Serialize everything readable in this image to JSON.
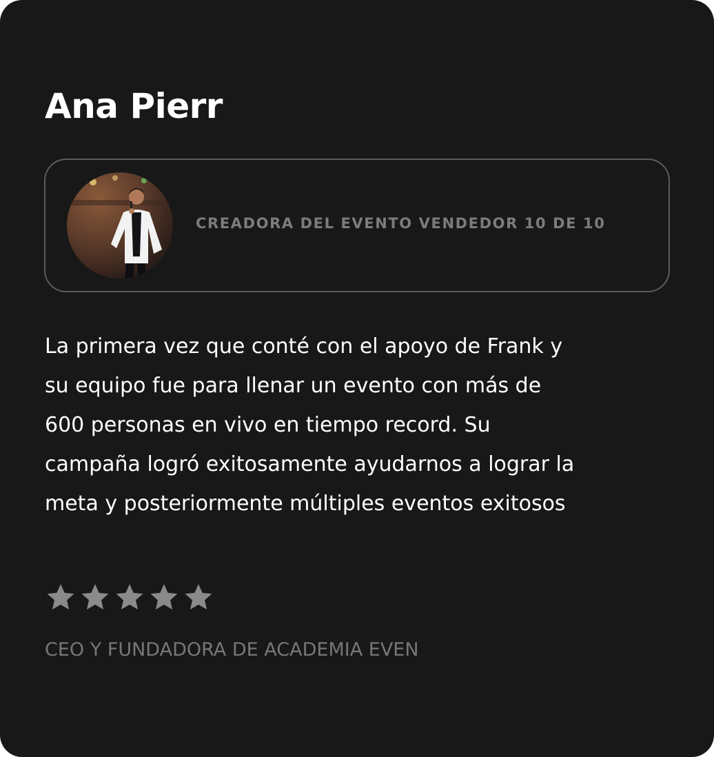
{
  "testimonial": {
    "name": "Ana Pierr",
    "role": "CREADORA DEL EVENTO VENDEDOR 10 DE 10",
    "quote_lines": [
      "La primera vez que conté con el apoyo de Frank y",
      "su equipo fue para llenar un evento con más de",
      "600 personas en vivo en tiempo record. Su",
      "campaña logró exitosamente ayudarnos a lograr la",
      "meta y posteriormente múltiples eventos exitosos"
    ],
    "rating": {
      "value": 5,
      "max": 5
    },
    "job_title": "CEO Y FUNDADORA DE ACADEMIA EVEN"
  },
  "avatar": {
    "icon": "profile-photo"
  },
  "colors": {
    "card_background": "#181818",
    "border": "#5c5c5c",
    "heading": "#ffffff",
    "muted_text": "#7c7c7c",
    "star": "#8a8a8a"
  }
}
